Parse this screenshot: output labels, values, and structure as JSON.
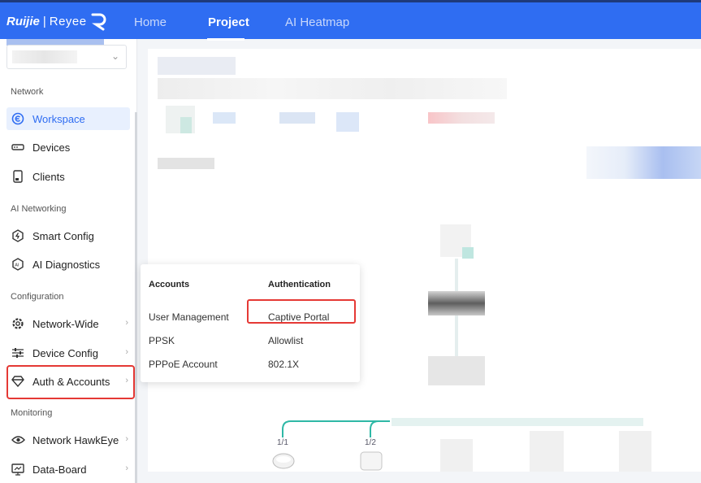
{
  "brand": {
    "ruijie": "Ruijie",
    "reyee": "Reyee"
  },
  "topnav": {
    "tabs": [
      {
        "label": "Home"
      },
      {
        "label": "Project"
      },
      {
        "label": "AI Heatmap"
      }
    ]
  },
  "sidebar": {
    "sections": {
      "network": "Network",
      "ai_networking": "AI Networking",
      "configuration": "Configuration",
      "monitoring": "Monitoring"
    },
    "items": [
      {
        "label": "Workspace",
        "icon": "workspace-icon",
        "active": true
      },
      {
        "label": "Devices",
        "icon": "devices-icon"
      },
      {
        "label": "Clients",
        "icon": "clients-icon"
      },
      {
        "label": "Smart Config",
        "icon": "smart-config-icon"
      },
      {
        "label": "AI Diagnostics",
        "icon": "ai-diagnostics-icon"
      },
      {
        "label": "Network-Wide",
        "icon": "gear-icon"
      },
      {
        "label": "Device Config",
        "icon": "sliders-icon"
      },
      {
        "label": "Auth & Accounts",
        "icon": "diamond-icon"
      },
      {
        "label": "Network HawkEye",
        "icon": "eye-icon"
      },
      {
        "label": "Data-Board",
        "icon": "monitor-icon"
      }
    ]
  },
  "popup": {
    "accounts_header": "Accounts",
    "auth_header": "Authentication",
    "accounts": [
      "User Management",
      "PPSK",
      "PPPoE Account"
    ],
    "authentication": [
      "Captive Portal",
      "Allowlist",
      "802.1X"
    ]
  },
  "topology": {
    "ports": [
      "1/1",
      "1/2"
    ]
  },
  "colors": {
    "primary": "#2f6df2",
    "highlight": "#e53935",
    "link": "#2fb8a6"
  }
}
